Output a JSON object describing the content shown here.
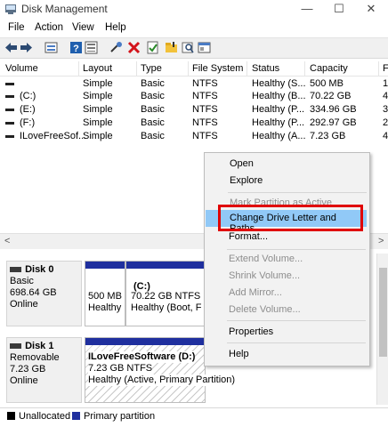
{
  "window": {
    "title": "Disk Management",
    "minimize": "—",
    "maximize": "☐",
    "close": "✕"
  },
  "menu": [
    "File",
    "Action",
    "View",
    "Help"
  ],
  "toolbar": [
    "back-icon",
    "forward-icon",
    "disk-list-icon",
    "help-icon",
    "list-icon",
    "connect-icon",
    "delete-icon",
    "properties-check-icon",
    "folder-icon",
    "search-icon",
    "console-icon"
  ],
  "columns": [
    "Volume",
    "Layout",
    "Type",
    "File System",
    "Status",
    "Capacity",
    "F"
  ],
  "volumes": [
    {
      "volume": "",
      "layout": "Simple",
      "type": "Basic",
      "fs": "NTFS",
      "status": "Healthy (S...",
      "capacity": "500 MB",
      "free": "1"
    },
    {
      "volume": "(C:)",
      "layout": "Simple",
      "type": "Basic",
      "fs": "NTFS",
      "status": "Healthy (B...",
      "capacity": "70.22 GB",
      "free": "4"
    },
    {
      "volume": "(E:)",
      "layout": "Simple",
      "type": "Basic",
      "fs": "NTFS",
      "status": "Healthy (P...",
      "capacity": "334.96 GB",
      "free": "3"
    },
    {
      "volume": "(F:)",
      "layout": "Simple",
      "type": "Basic",
      "fs": "NTFS",
      "status": "Healthy (P...",
      "capacity": "292.97 GB",
      "free": "2"
    },
    {
      "volume": "ILoveFreeSof...",
      "layout": "Simple",
      "type": "Basic",
      "fs": "NTFS",
      "status": "Healthy (A...",
      "capacity": "7.23 GB",
      "free": "4"
    }
  ],
  "disk0": {
    "name": "Disk 0",
    "type": "Basic",
    "size": "698.64 GB",
    "state": "Online",
    "p1_size": "500 MB",
    "p1_status": "Healthy",
    "p2_label": "(C:)",
    "p2_size": "70.22 GB NTFS",
    "p2_status": "Healthy (Boot, F"
  },
  "disk1": {
    "name": "Disk 1",
    "type": "Removable",
    "size": "7.23 GB",
    "state": "Online",
    "p_label": "ILoveFreeSoftware  (D:)",
    "p_size": "7.23 GB NTFS",
    "p_status": "Healthy (Active, Primary Partition)"
  },
  "legend": {
    "unallocated": "Unallocated",
    "primary": "Primary partition",
    "unallocated_color": "#000000",
    "primary_color": "#1f2f9e"
  },
  "context_menu": {
    "open": "Open",
    "explore": "Explore",
    "mark_active": "Mark Partition as Active",
    "change_letter": "Change Drive Letter and Paths...",
    "format": "Format...",
    "extend": "Extend Volume...",
    "shrink": "Shrink Volume...",
    "add_mirror": "Add Mirror...",
    "delete": "Delete Volume...",
    "properties": "Properties",
    "help": "Help"
  },
  "scroll": {
    "left": "<",
    "right": ">"
  },
  "accent_highlight": "#e00000"
}
